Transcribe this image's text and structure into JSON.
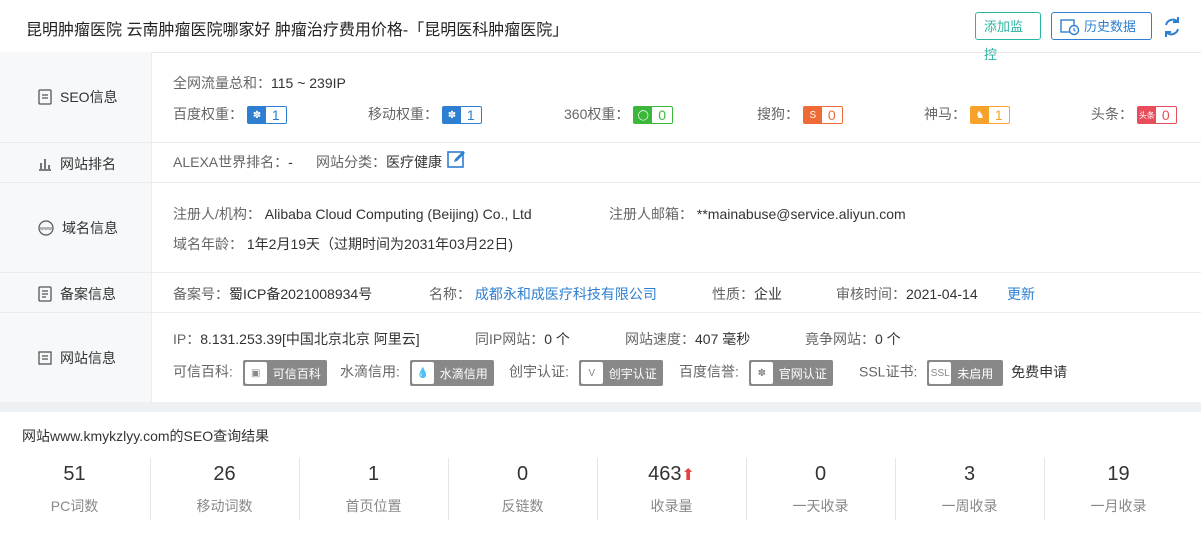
{
  "header": {
    "title": "昆明肿瘤医院 云南肿瘤医院哪家好 肿瘤治疗费用价格-「昆明医科肿瘤医院」",
    "monitor_btn": "添加监控",
    "history_btn": "历史数据",
    "brand_color": "#2eb4a2",
    "link_color": "#2e7fd1"
  },
  "seo": {
    "label": "SEO信息",
    "traffic_label": "全网流量总和：",
    "traffic_value": "115 ~ 239IP",
    "weights": [
      {
        "label": "百度权重：",
        "value": "1",
        "icon": "baidu-paw-icon",
        "color": "#2e7fd1"
      },
      {
        "label": "移动权重：",
        "value": "1",
        "icon": "baidu-paw-icon",
        "color": "#2e7fd1"
      },
      {
        "label": "360权重：",
        "value": "0",
        "icon": "360-icon",
        "color": "#3bb83b"
      },
      {
        "label": "搜狗：",
        "value": "0",
        "icon": "sogou-icon",
        "color": "#f06a35"
      },
      {
        "label": "神马：",
        "value": "1",
        "icon": "shenma-icon",
        "color": "#f7a22b"
      },
      {
        "label": "头条：",
        "value": "0",
        "icon": "toutiao-icon",
        "color": "#e84d5b"
      }
    ]
  },
  "rank": {
    "label": "网站排名",
    "alexa_label": "ALEXA世界排名：",
    "alexa_value": "-",
    "category_label": "网站分类：",
    "category_value": "医疗健康"
  },
  "domain": {
    "label": "域名信息",
    "registrant_label": "注册人/机构：",
    "registrant_value": "Alibaba Cloud Computing (Beijing) Co., Ltd",
    "email_label": "注册人邮箱：",
    "email_value": "**mainabuse@service.aliyun.com",
    "age_label": "域名年龄：",
    "age_value": "1年2月19天（过期时间为2031年03月22日)"
  },
  "icp": {
    "label": "备案信息",
    "number_label": "备案号：",
    "number_value": "蜀ICP备2021008934号",
    "name_label": "名称：",
    "name_value": "成都永和成医疗科技有限公司",
    "type_label": "性质：",
    "type_value": "企业",
    "date_label": "审核时间：",
    "date_value": "2021-04-14",
    "update_link": "更新"
  },
  "site": {
    "label": "网站信息",
    "ip_label": "IP：",
    "ip_value": "8.131.253.39[中国北京北京 阿里云]",
    "sameip_label": "同IP网站：",
    "sameip_value": "0 个",
    "speed_label": "网站速度：",
    "speed_value": "407 毫秒",
    "compete_label": "竟争网站：",
    "compete_value": "0 个",
    "credits": [
      {
        "label": "可信百科:",
        "badge": "可信百科",
        "icon": "trust-icon"
      },
      {
        "label": "水滴信用:",
        "badge": "水滴信用",
        "icon": "water-drop-icon"
      },
      {
        "label": "创宇认证:",
        "badge": "创宇认证",
        "icon": "chuangyu-icon"
      },
      {
        "label": "百度信誉:",
        "badge": "官网认证",
        "icon": "baidu-paw-icon"
      },
      {
        "label": "SSL证书:",
        "badge": "未启用",
        "icon": "ssl-icon"
      }
    ],
    "free_apply": "免费申请"
  },
  "results": {
    "title": "网站www.kmykzlyy.com的SEO查询结果",
    "stats": [
      {
        "value": "51",
        "label": "PC词数"
      },
      {
        "value": "26",
        "label": "移动词数"
      },
      {
        "value": "1",
        "label": "首页位置"
      },
      {
        "value": "0",
        "label": "反链数"
      },
      {
        "value": "463",
        "label": "收录量",
        "trend": "up"
      },
      {
        "value": "0",
        "label": "一天收录"
      },
      {
        "value": "3",
        "label": "一周收录"
      },
      {
        "value": "19",
        "label": "一月收录"
      }
    ]
  }
}
